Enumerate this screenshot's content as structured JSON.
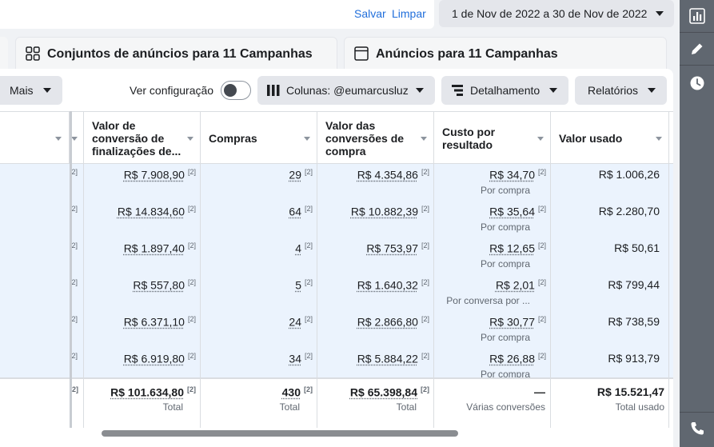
{
  "header": {
    "save_label": "Salvar",
    "clear_label": "Limpar",
    "date_range": "1 de Nov de 2022 a 30 de Nov de 2022"
  },
  "tabs": [
    {
      "label": "Conjuntos de anúncios para 11 Campanhas",
      "icon": "grid-icon"
    },
    {
      "label": "Anúncios para 11 Campanhas",
      "icon": "ad-icon"
    }
  ],
  "toolbar": {
    "more_label": "Mais",
    "view_config_label": "Ver configuração",
    "view_config_on": false,
    "columns_label": "Colunas: @eumarcusluz",
    "breakdown_label": "Detalhamento",
    "reports_label": "Relatórios"
  },
  "table": {
    "columns": [
      {
        "line1": "Valor de",
        "line2": "conversão de",
        "line3": "finalizações de..."
      },
      {
        "line1": "Compras",
        "line2": "",
        "line3": ""
      },
      {
        "line1": "Valor das",
        "line2": "conversões de",
        "line3": "compra"
      },
      {
        "line1": "Custo por",
        "line2": "resultado",
        "line3": ""
      },
      {
        "line1": "Valor usado",
        "line2": "",
        "line3": ""
      }
    ],
    "footnote": "[2]",
    "rows": [
      {
        "checkout_value": "R$ 7.908,90",
        "purchases": "29",
        "purchase_value": "R$ 4.354,86",
        "cost": "R$ 34,70",
        "cost_type": "Por compra",
        "spent": "R$ 1.006,26"
      },
      {
        "checkout_value": "R$ 14.834,60",
        "purchases": "64",
        "purchase_value": "R$ 10.882,39",
        "cost": "R$ 35,64",
        "cost_type": "Por compra",
        "spent": "R$ 2.280,70"
      },
      {
        "checkout_value": "R$ 1.897,40",
        "purchases": "4",
        "purchase_value": "R$ 753,97",
        "cost": "R$ 12,65",
        "cost_type": "Por compra",
        "spent": "R$ 50,61"
      },
      {
        "checkout_value": "R$ 557,80",
        "purchases": "5",
        "purchase_value": "R$ 1.640,32",
        "cost": "R$ 2,01",
        "cost_type": "Por conversa por ...",
        "spent": "R$ 799,44"
      },
      {
        "checkout_value": "R$ 6.371,10",
        "purchases": "24",
        "purchase_value": "R$ 2.866,80",
        "cost": "R$ 30,77",
        "cost_type": "Por compra",
        "spent": "R$ 738,59"
      },
      {
        "checkout_value": "R$ 6.919,80",
        "purchases": "34",
        "purchase_value": "R$ 5.884,22",
        "cost": "R$ 26,88",
        "cost_type": "Por compra",
        "spent": "R$ 913,79"
      }
    ],
    "totals": {
      "checkout_value": "R$ 101.634,80",
      "checkout_label": "Total",
      "purchases": "430",
      "purchases_label": "Total",
      "purchase_value": "R$ 65.398,84",
      "purchase_value_label": "Total",
      "cost": "—",
      "cost_label": "Várias conversões",
      "spent": "R$ 15.521,47",
      "spent_label": "Total usado"
    }
  },
  "rail": {
    "icons": [
      "bar-chart-icon",
      "pencil-icon",
      "clock-icon",
      "phone-icon"
    ],
    "bg_color": "#606770"
  },
  "colors": {
    "accent": "#216fdb",
    "row_selected": "#ebf3fd"
  }
}
